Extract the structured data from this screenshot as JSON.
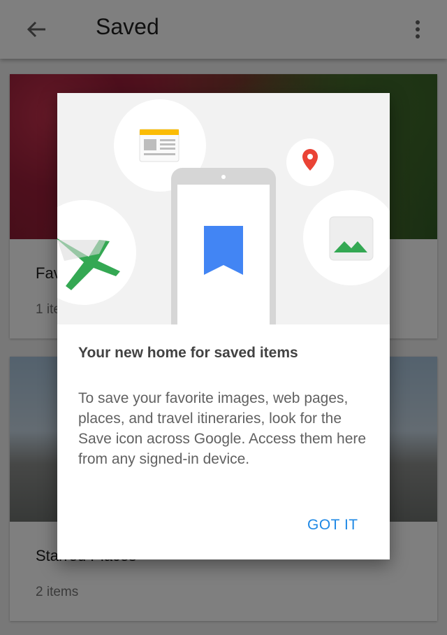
{
  "appbar": {
    "title": "Saved",
    "back_icon": "arrow-back-icon",
    "menu_icon": "more-vert-icon"
  },
  "cards": [
    {
      "title": "Favorites",
      "count": "1 item"
    },
    {
      "title": "Starred Places",
      "count": "2 items"
    }
  ],
  "dialog": {
    "title": "Your new home for saved items",
    "body": "To save your favorite images, web pages, places, and travel itineraries, look for the Save icon across Google. Access them here from any signed-in device.",
    "action": "GOT IT"
  },
  "colors": {
    "accent": "#1e88e5",
    "bookmark": "#4285f4",
    "plane": "#34a853",
    "pin": "#ea4335",
    "news_bar": "#fbbc05"
  }
}
